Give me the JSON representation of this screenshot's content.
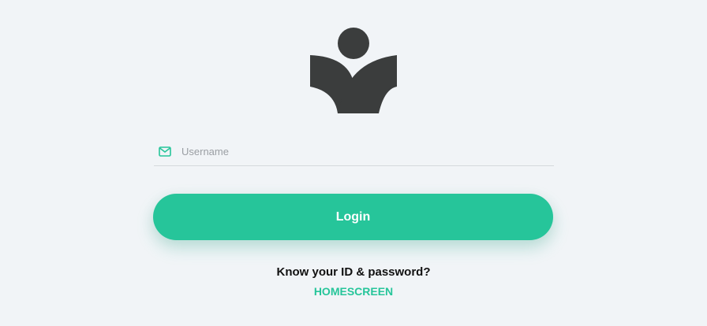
{
  "logo": {
    "icon": "person-arms-raised-logo",
    "color": "#3b3d3d"
  },
  "form": {
    "username": {
      "icon": "mail-icon",
      "placeholder": "Username",
      "value": ""
    },
    "login_label": "Login"
  },
  "footer": {
    "prompt": "Know your ID & password?",
    "link_label": "HOMESCREEN"
  },
  "colors": {
    "accent": "#26c59a",
    "background": "#f1f4f7",
    "logo": "#3b3d3d"
  }
}
